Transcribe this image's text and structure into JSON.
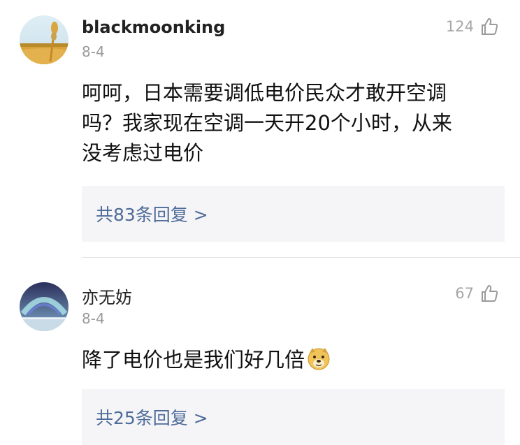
{
  "comments": [
    {
      "avatar_icon": "wheat-field-avatar",
      "username": "blackmoonking",
      "date": "8-4",
      "likes": "124",
      "text": "呵呵，日本需要调低电价民众才敢开空调吗？我家现在空调一天开20个小时，从来没考虑过电价",
      "text_lines": [
        "呵呵，日本需要调低电价民众才敢开空调",
        "吗？我家现在空调一天开20个小时，从来",
        "没考虑过电价"
      ],
      "replies": "共83条回复 >"
    },
    {
      "avatar_icon": "aurora-avatar",
      "username": "亦无妨",
      "date": "8-4",
      "likes": "67",
      "text": "降了电价也是我们好几倍",
      "emoji_icon": "doge-emoji",
      "replies": "共25条回复 >"
    }
  ],
  "icons": {
    "like": "thumbs-up-outline-icon"
  },
  "colors": {
    "reply_link": "#4e6b99",
    "muted": "#9a9a9a",
    "reply_bg": "#f5f5f7"
  }
}
